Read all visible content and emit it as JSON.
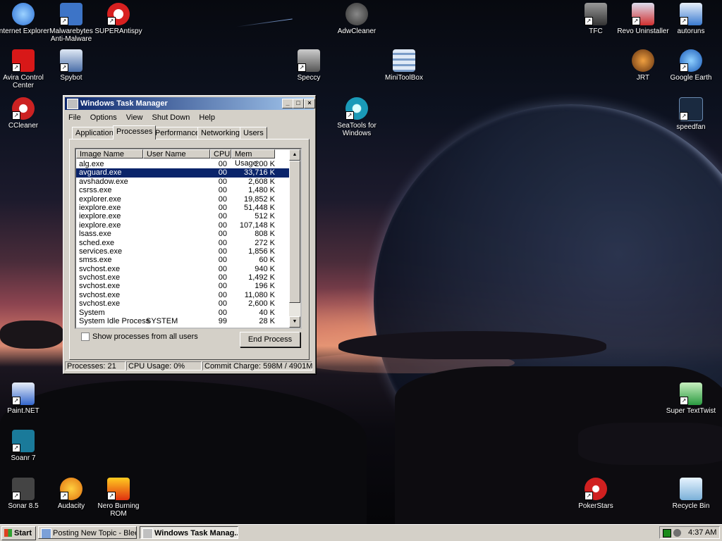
{
  "desktop": {
    "icons_left": [
      {
        "label": "Internet Explorer",
        "icon": "ie-icon",
        "color": "#2a6fd6"
      },
      {
        "label": "Malwarebytes Anti-Malware",
        "icon": "malwarebytes-icon",
        "color": "#3d74c7"
      },
      {
        "label": "SUPERAntispy",
        "icon": "superantispyware-icon",
        "color": "#d82020"
      },
      {
        "label": "Avira Control Center",
        "icon": "avira-icon",
        "color": "#d81818"
      },
      {
        "label": "Spybot",
        "icon": "spybot-icon",
        "color": "#4a6ea8"
      },
      {
        "label": "CCleaner",
        "icon": "ccleaner-icon",
        "color": "#cc2222"
      },
      {
        "label": "Paint.NET",
        "icon": "paintnet-icon",
        "color": "#3366cc"
      },
      {
        "label": "Soanr 7",
        "icon": "sonar-icon",
        "color": "#1a7a9a"
      },
      {
        "label": "Sonar 8.5",
        "icon": "sonar85-icon",
        "color": "#444444"
      },
      {
        "label": "Audacity",
        "icon": "audacity-icon",
        "color": "#e07010"
      },
      {
        "label": "Nero Burning ROM",
        "icon": "nero-icon",
        "color": "#e03010"
      }
    ],
    "icons_center": [
      {
        "label": "AdwCleaner",
        "icon": "adwcleaner-icon",
        "color": "#555555"
      },
      {
        "label": "Speccy",
        "icon": "speccy-icon",
        "color": "#606060"
      },
      {
        "label": "MiniToolBox",
        "icon": "minitoolbox-icon",
        "color": "#a0b8d8"
      },
      {
        "label": "SeaTools for Windows",
        "icon": "seatools-icon",
        "color": "#1a9ab8"
      }
    ],
    "icons_right": [
      {
        "label": "TFC",
        "icon": "tfc-icon",
        "color": "#606060"
      },
      {
        "label": "Revo Uninstaller",
        "icon": "revo-icon",
        "color": "#d03030"
      },
      {
        "label": "autoruns",
        "icon": "autoruns-icon",
        "color": "#3a7ad0"
      },
      {
        "label": "JRT",
        "icon": "jrt-icon",
        "color": "#c07020"
      },
      {
        "label": "Google Earth",
        "icon": "google-earth-icon",
        "color": "#2a7ad8"
      },
      {
        "label": "speedfan",
        "icon": "speedfan-icon",
        "color": "#1a2a40"
      },
      {
        "label": "Super TextTwist",
        "icon": "super-texttwist-icon",
        "color": "#2a9a40"
      },
      {
        "label": "PokerStars",
        "icon": "pokerstars-icon",
        "color": "#d02020"
      },
      {
        "label": "Recycle Bin",
        "icon": "recycle-bin-icon",
        "color": "#7ab0d8"
      }
    ]
  },
  "taskmgr": {
    "title": "Windows Task Manager",
    "window_controls": {
      "minimize": "_",
      "maximize": "□",
      "close": "×"
    },
    "menu": [
      "File",
      "Options",
      "View",
      "Shut Down",
      "Help"
    ],
    "tabs": [
      "Applications",
      "Processes",
      "Performance",
      "Networking",
      "Users"
    ],
    "active_tab": "Processes",
    "columns": [
      "Image Name",
      "User Name",
      "CPU",
      "Mem Usage"
    ],
    "processes": [
      {
        "name": "alg.exe",
        "user": "",
        "cpu": "00",
        "mem": "200 K"
      },
      {
        "name": "avguard.exe",
        "user": "",
        "cpu": "00",
        "mem": "33,716 K",
        "selected": true
      },
      {
        "name": "avshadow.exe",
        "user": "",
        "cpu": "00",
        "mem": "2,608 K"
      },
      {
        "name": "csrss.exe",
        "user": "",
        "cpu": "00",
        "mem": "1,480 K"
      },
      {
        "name": "explorer.exe",
        "user": "",
        "cpu": "00",
        "mem": "19,852 K"
      },
      {
        "name": "iexplore.exe",
        "user": "",
        "cpu": "00",
        "mem": "51,448 K"
      },
      {
        "name": "iexplore.exe",
        "user": "",
        "cpu": "00",
        "mem": "512 K"
      },
      {
        "name": "iexplore.exe",
        "user": "",
        "cpu": "00",
        "mem": "107,148 K"
      },
      {
        "name": "lsass.exe",
        "user": "",
        "cpu": "00",
        "mem": "808 K"
      },
      {
        "name": "sched.exe",
        "user": "",
        "cpu": "00",
        "mem": "272 K"
      },
      {
        "name": "services.exe",
        "user": "",
        "cpu": "00",
        "mem": "1,856 K"
      },
      {
        "name": "smss.exe",
        "user": "",
        "cpu": "00",
        "mem": "60 K"
      },
      {
        "name": "svchost.exe",
        "user": "",
        "cpu": "00",
        "mem": "940 K"
      },
      {
        "name": "svchost.exe",
        "user": "",
        "cpu": "00",
        "mem": "1,492 K"
      },
      {
        "name": "svchost.exe",
        "user": "",
        "cpu": "00",
        "mem": "196 K"
      },
      {
        "name": "svchost.exe",
        "user": "",
        "cpu": "00",
        "mem": "11,080 K"
      },
      {
        "name": "svchost.exe",
        "user": "",
        "cpu": "00",
        "mem": "2,600 K"
      },
      {
        "name": "System",
        "user": "",
        "cpu": "00",
        "mem": "40 K"
      },
      {
        "name": "System Idle Process",
        "user": "SYSTEM",
        "cpu": "99",
        "mem": "28 K"
      }
    ],
    "show_all_label": "Show processes from all users",
    "show_all_checked": false,
    "end_process_label": "End Process",
    "status": {
      "processes": "Processes: 21",
      "cpu": "CPU Usage: 0%",
      "commit": "Commit Charge: 598M / 4901M"
    }
  },
  "taskbar": {
    "start_label": "Start",
    "buttons": [
      {
        "label": "Posting New Topic - Blee...",
        "active": false
      },
      {
        "label": "Windows Task Manag...",
        "active": true
      }
    ],
    "clock": "4:37 AM"
  },
  "colors": {
    "title_gradient_start": "#0a246a",
    "title_gradient_end": "#a6caf0",
    "selection": "#0a246a",
    "chrome": "#d4d0c8"
  }
}
